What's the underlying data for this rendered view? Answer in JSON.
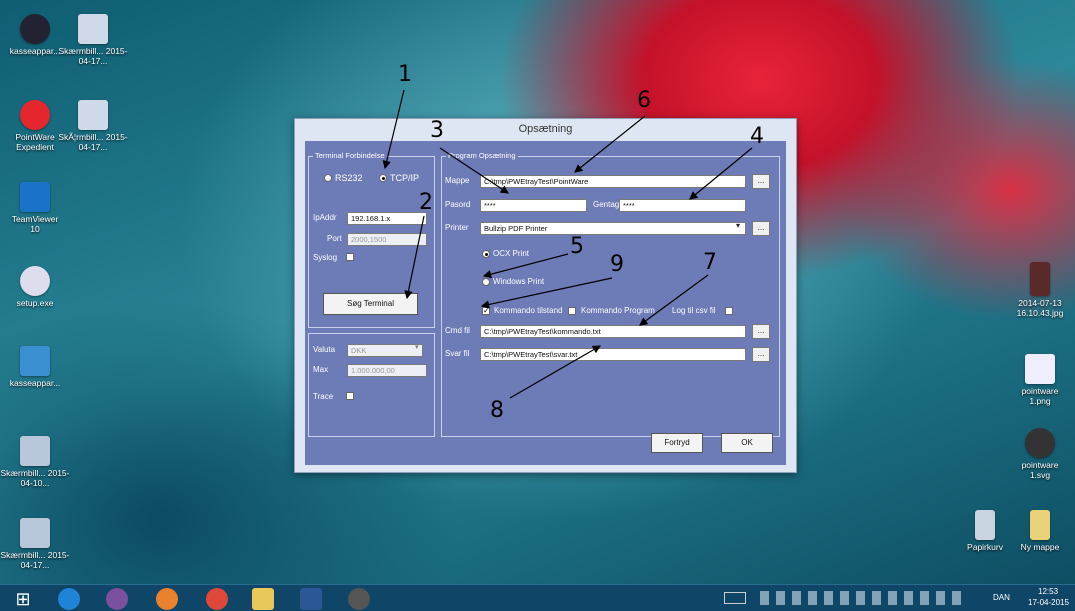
{
  "desktop": {
    "icons": [
      {
        "label": "kasseappar...",
        "name": "kasseapparat-shortcut-icon"
      },
      {
        "label": "Skærmbill... 2015-04-17...",
        "name": "screenshot-file-icon"
      },
      {
        "label": "PointWare Expedient",
        "name": "pointware-expedient-icon"
      },
      {
        "label": "SkÃ¦rmbill... 2015-04-17...",
        "name": "screenshot-file-icon-2"
      },
      {
        "label": "TeamViewer 10",
        "name": "teamviewer-icon"
      },
      {
        "label": "setup.exe",
        "name": "setup-exe-icon"
      },
      {
        "label": "kasseappar...",
        "name": "kasseapparat-folder-icon"
      },
      {
        "label": "Skærmbill... 2015-04-10...",
        "name": "screenshot-file-icon-3"
      },
      {
        "label": "Skærmbill... 2015-04-17...",
        "name": "screenshot-file-icon-4"
      },
      {
        "label": "2014-07-13 16.10.43.jpg",
        "name": "photo-file-icon"
      },
      {
        "label": "pointware 1.png",
        "name": "pointware-png-icon"
      },
      {
        "label": "pointware 1.svg",
        "name": "pointware-svg-icon"
      },
      {
        "label": "Papirkurv",
        "name": "recycle-bin-icon"
      },
      {
        "label": "Ny mappe",
        "name": "new-folder-icon"
      }
    ]
  },
  "dialog": {
    "title": "Opsætning",
    "terminal": {
      "group_label": "Terminal Forbindelse",
      "rs232": "RS232",
      "tcpip": "TCP/IP",
      "ipaddr_label": "IpAddr",
      "ipaddr_value": "192.168.1.x",
      "port_label": "Port",
      "port_value": "2000,1500",
      "syslog_label": "Syslog",
      "search_button": "Søg Terminal"
    },
    "valuta": {
      "label": "Valuta",
      "value": "DKK",
      "max_label": "Max",
      "max_value": "1.000.000,00",
      "trace_label": "Trace"
    },
    "program": {
      "group_label": "Program Opsætning",
      "mappe_label": "Mappe",
      "mappe_value": "C:\\tmp\\PWEtrayTest\\PointWare",
      "pasord_label": "Pasord",
      "pasord_value": "****",
      "gentag_label": "Gentag",
      "gentag_value": "****",
      "printer_label": "Printer",
      "printer_value": "Bullzip PDF Printer",
      "ocx_print": "OCX Print",
      "windows_print": "Windows Print",
      "kommando_tilstand": "Kommando tilstand",
      "kommando_program": "Kommando Program",
      "log_csv": "Log til csv fil",
      "cmd_label": "Cmd fil",
      "cmd_value": "C:\\tmp\\PWEtrayTest\\kommando.txt",
      "svar_label": "Svar fil",
      "svar_value": "C:\\tmp\\PWEtrayTest\\svar.txt",
      "browse": "..."
    },
    "fortryd": "Fortryd",
    "ok": "OK"
  },
  "annotations": [
    "1",
    "2",
    "3",
    "4",
    "5",
    "6",
    "7",
    "8",
    "9"
  ],
  "taskbar": {
    "language": "DAN",
    "time": "12:53",
    "date": "17-04-2015"
  }
}
